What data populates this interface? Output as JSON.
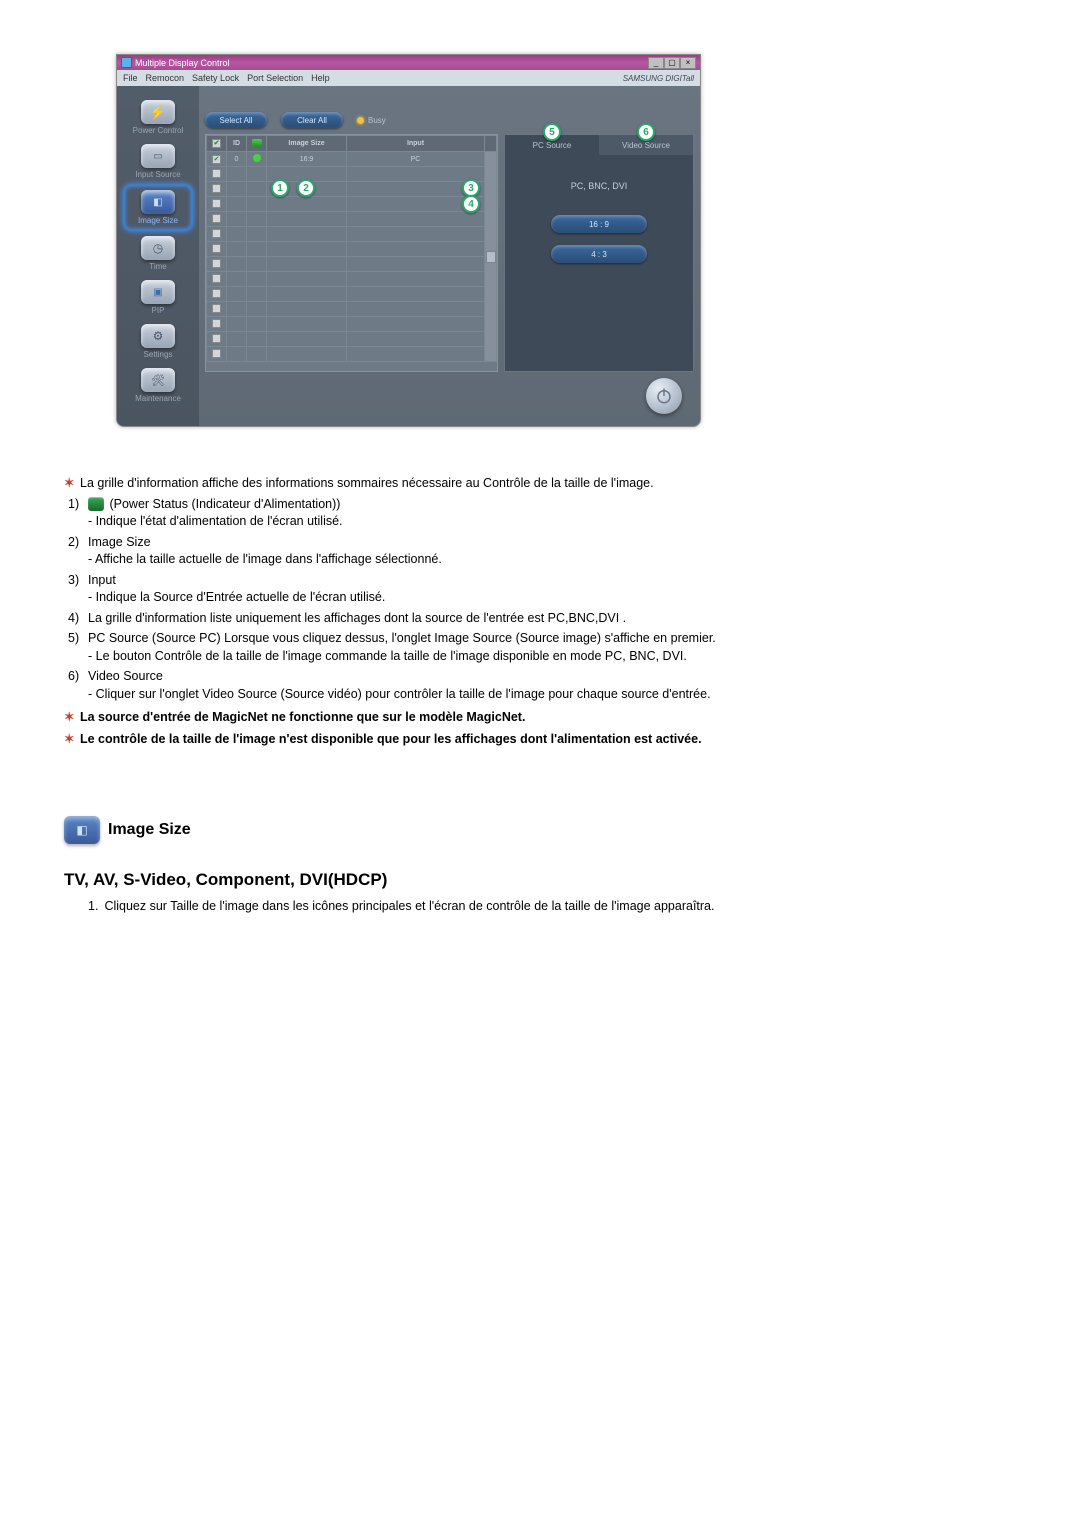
{
  "app": {
    "title": "Multiple Display Control",
    "menu": [
      "File",
      "Remocon",
      "Safety Lock",
      "Port Selection",
      "Help"
    ],
    "brand": "SAMSUNG DIGITall"
  },
  "sidebar": {
    "items": [
      {
        "label": "Power Control"
      },
      {
        "label": "Input Source"
      },
      {
        "label": "Image Size"
      },
      {
        "label": "Time"
      },
      {
        "label": "PIP"
      },
      {
        "label": "Settings"
      },
      {
        "label": "Maintenance"
      }
    ]
  },
  "top_buttons": {
    "select_all": "Select All",
    "clear_all": "Clear All",
    "busy": "Busy"
  },
  "grid": {
    "headers": {
      "chk": "",
      "id": "ID",
      "status": "",
      "imgsize": "Image Size",
      "input": "Input"
    },
    "row0": {
      "id": "0",
      "imgsize": "16:9",
      "input": "PC"
    }
  },
  "right": {
    "tab_pc": "PC Source",
    "tab_video": "Video Source",
    "src_label": "PC, BNC, DVI",
    "ratio1": "16 : 9",
    "ratio2": "4 : 3"
  },
  "markers": {
    "m1": "1",
    "m2": "2",
    "m3": "3",
    "m4": "4",
    "m5": "5",
    "m6": "6"
  },
  "doc": {
    "intro": "La grille d'information affiche des informations sommaires nécessaire au Contrôle de la taille de l'image.",
    "n1": "1)",
    "n1a": "(Power Status (Indicateur d'Alimentation))",
    "n1b": "- Indique l'état d'alimentation de l'écran utilisé.",
    "n2": "2)",
    "n2a": "Image Size",
    "n2b": "- Affiche la taille actuelle de l'image dans l'affichage sélectionné.",
    "n3": "3)",
    "n3a": "Input",
    "n3b": "- Indique la Source d'Entrée actuelle de l'écran utilisé.",
    "n4": "4)",
    "n4a": "La grille d'information liste uniquement les affichages dont la source de l'entrée est PC,BNC,DVI .",
    "n5": "5)",
    "n5a": "PC Source (Source PC) Lorsque vous cliquez dessus, l'onglet Image Source (Source image) s'affiche en premier.",
    "n5b": "- Le bouton Contrôle de la taille de l'image commande la taille de l'image disponible en mode PC, BNC, DVI.",
    "n6": "6)",
    "n6a": "Video Source",
    "n6b": "- Cliquer sur l'onglet Video Source (Source vidéo) pour contrôler la taille de l'image pour chaque source d'entrée.",
    "star1": "La source d'entrée de MagicNet ne fonctionne que sur le modèle MagicNet.",
    "star2": "Le contrôle de la taille de l'image n'est disponible que pour les affichages dont l'alimentation est activée.",
    "section_title": "Image Size",
    "sub_heading": "TV, AV, S-Video, Component, DVI(HDCP)",
    "last_1": "1.",
    "last_1t": "Cliquez sur Taille de l'image dans les icônes principales et l'écran de contrôle de la taille de l'image apparaîtra."
  }
}
